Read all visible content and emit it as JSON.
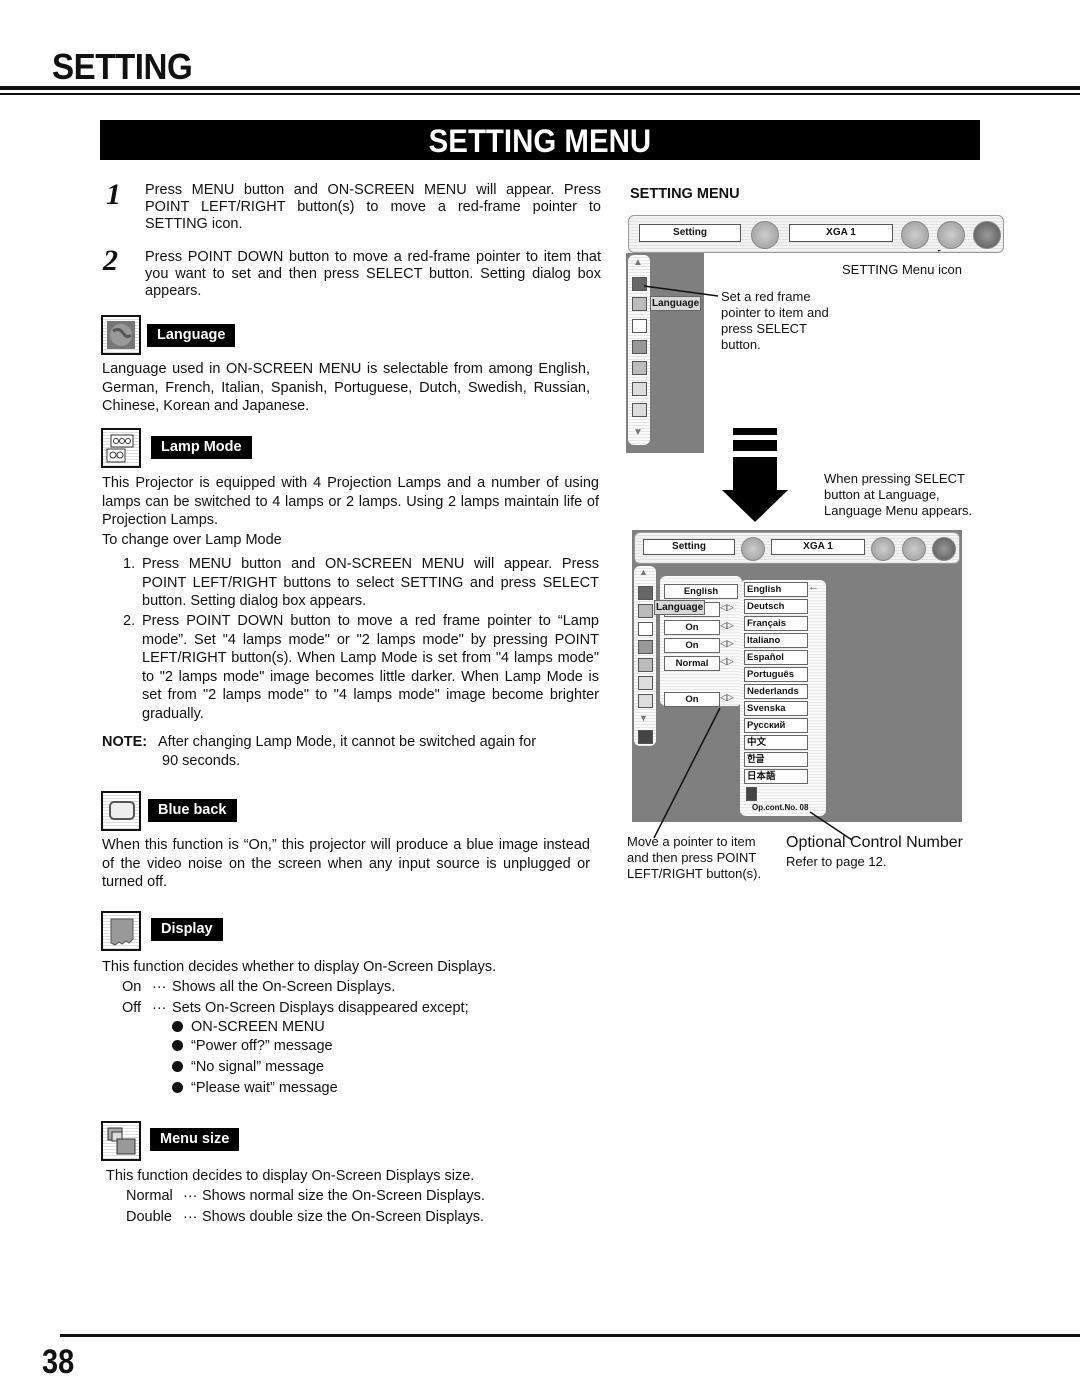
{
  "header": {
    "section_title": "SETTING",
    "banner_title": "SETTING MENU"
  },
  "steps": [
    {
      "number": "1",
      "text": "Press MENU button and ON-SCREEN MENU will appear.  Press POINT LEFT/RIGHT button(s) to move a red-frame pointer to SETTING icon."
    },
    {
      "number": "2",
      "text": "Press POINT DOWN button to move a red-frame pointer to item that you want to set and then press SELECT button.  Setting dialog box appears."
    }
  ],
  "sections": {
    "language": {
      "label": "Language",
      "icon": "globe-icon",
      "text": "Language used in ON-SCREEN MENU is selectable from among English, German, French, Italian, Spanish, Portuguese, Dutch, Swedish, Russian, Chinese, Korean and Japanese."
    },
    "lamp_mode": {
      "label": "Lamp Mode",
      "icon": "lamp-icon",
      "text": "This Projector is equipped with 4 Projection Lamps and a number of using lamps can be switched to 4 lamps or 2 lamps.  Using 2 lamps maintain life of Projection Lamps.",
      "subheading": "To change over Lamp Mode",
      "steps": [
        {
          "number": "1.",
          "text": "Press MENU button and ON-SCREEN MENU will appear.  Press POINT LEFT/RIGHT buttons to select SETTING and press SELECT button.  Setting dialog box appears."
        },
        {
          "number": "2.",
          "text": "Press POINT DOWN button to move a red frame pointer to “Lamp mode”.  Set \"4 lamps mode\" or \"2 lamps mode\" by pressing POINT LEFT/RIGHT button(s).  When Lamp Mode is set from \"4 lamps mode\" to \"2 lamps mode\" image becomes little darker.  When Lamp Mode is set from \"2 lamps mode\" to \"4 lamps mode\" image become brighter gradually."
        }
      ],
      "note_label": "NOTE:",
      "note_text": "After changing Lamp Mode, it cannot be switched again for",
      "note_text2": "90 seconds."
    },
    "blue_back": {
      "label": "Blue back",
      "icon": "blue-back-icon",
      "text": "When this function is “On,” this projector will produce a blue image instead of the video noise on the screen when any input source is unplugged or turned off."
    },
    "display": {
      "label": "Display",
      "icon": "display-icon",
      "text": "This function decides whether to display On-Screen Displays.",
      "options": [
        {
          "key": "On",
          "sep": "···",
          "desc": "Shows all the On-Screen Displays."
        },
        {
          "key": "Off",
          "sep": "···",
          "desc": "Sets On-Screen Displays disappeared except;"
        }
      ],
      "bullets": [
        "ON-SCREEN MENU",
        "“Power off?” message",
        "“No signal” message",
        "“Please wait” message"
      ]
    },
    "menu_size": {
      "label": "Menu size",
      "icon": "menu-size-icon",
      "text": "This function decides to display On-Screen Displays size.",
      "options": [
        {
          "key": "Normal",
          "sep": "···",
          "desc": "Shows normal size the On-Screen Displays."
        },
        {
          "key": "Double",
          "sep": "···",
          "desc": "Shows double size the On-Screen Displays."
        }
      ]
    }
  },
  "figure": {
    "heading": "SETTING MENU",
    "screen1": {
      "tab_label": "Setting",
      "source_label": "XGA 1",
      "tooltip": "Language",
      "callout_icon": "SETTING Menu icon",
      "callout_pointer": "Set a red frame pointer to item and press SELECT button."
    },
    "arrow_caption": "When pressing SELECT button at Language, Language Menu appears.",
    "screen2": {
      "tab_label": "Setting",
      "source_label": "XGA 1",
      "tooltip": "Language",
      "fields": [
        "English",
        "",
        "On",
        "On",
        "Normal",
        "On"
      ],
      "languages": [
        "English",
        "Deutsch",
        "Français",
        "Italiano",
        "Español",
        "Português",
        "Nederlands",
        "Svenska",
        "Русский",
        "中文",
        "한글",
        "日本語"
      ],
      "opcont": "Op.cont.No. 08"
    },
    "callout_move": "Move a pointer to item and then press POINT LEFT/RIGHT button(s).",
    "callout_opcont_title": "Optional Control Number",
    "callout_opcont_sub": "Refer to page 12."
  },
  "footer": {
    "page_number": "38"
  }
}
